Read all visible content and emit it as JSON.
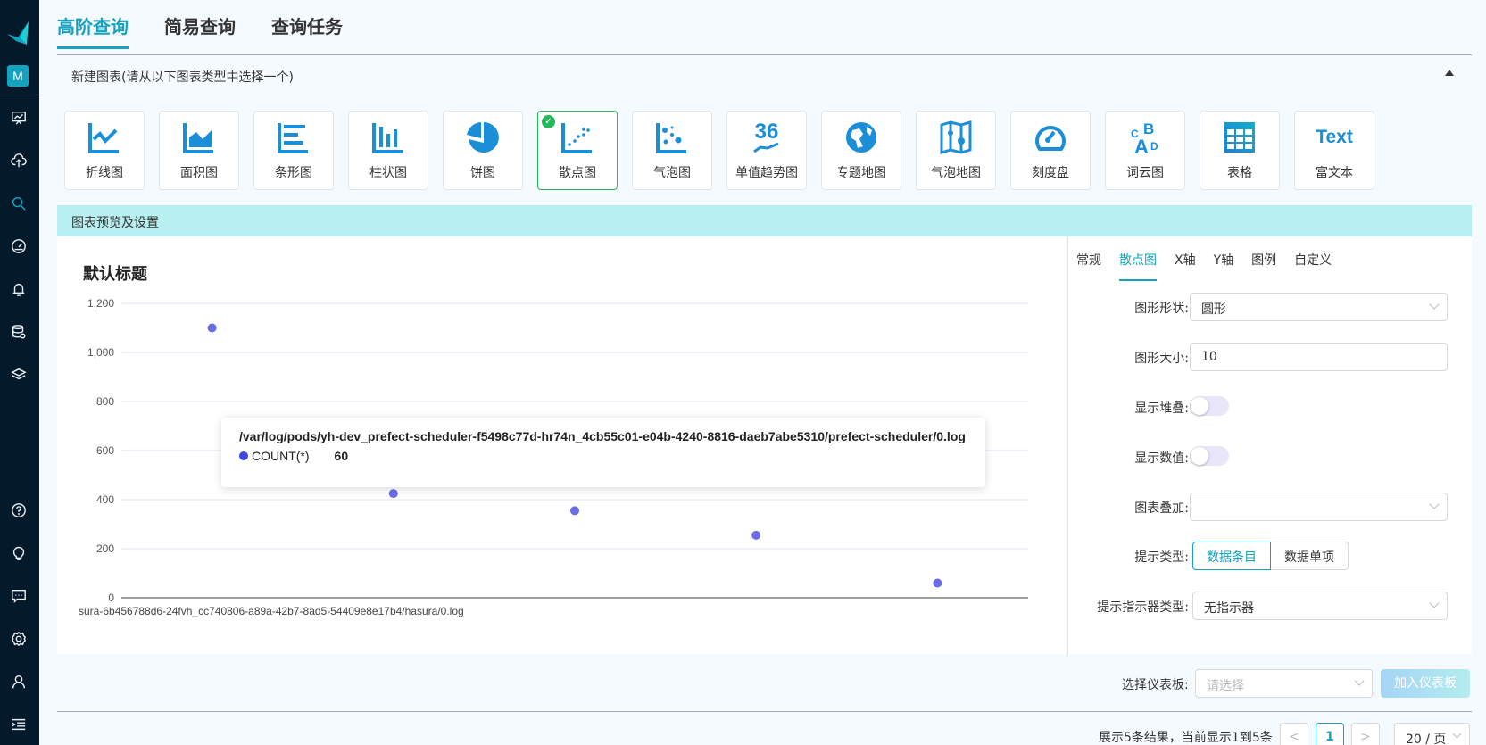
{
  "sidebar": {
    "logo": "bird-logo",
    "user_initial": "M",
    "icons_top": [
      "dashboard-presentation-icon",
      "cloud-upload-icon",
      "search-icon",
      "speedometer-icon",
      "bell-icon",
      "database-settings-icon",
      "layers-icon"
    ],
    "icons_bottom": [
      "help-icon",
      "lightbulb-icon",
      "chat-icon",
      "settings-icon",
      "user-icon",
      "menu-indent-icon"
    ],
    "active": "search-icon"
  },
  "top_tabs": [
    {
      "label": "高阶查询",
      "active": true
    },
    {
      "label": "简易查询",
      "active": false
    },
    {
      "label": "查询任务",
      "active": false
    }
  ],
  "new_chart_header": "新建图表(请从以下图表类型中选择一个)",
  "chart_types": [
    {
      "label": "折线图",
      "icon": "line-chart-icon"
    },
    {
      "label": "面积图",
      "icon": "area-chart-icon"
    },
    {
      "label": "条形图",
      "icon": "bar-chart-icon"
    },
    {
      "label": "柱状图",
      "icon": "column-chart-icon"
    },
    {
      "label": "饼图",
      "icon": "pie-chart-icon"
    },
    {
      "label": "散点图",
      "icon": "scatter-chart-icon",
      "selected": true
    },
    {
      "label": "气泡图",
      "icon": "bubble-chart-icon"
    },
    {
      "label": "单值趋势图",
      "icon": "single-value-trend-icon",
      "icon_text": "36"
    },
    {
      "label": "专题地图",
      "icon": "globe-map-icon"
    },
    {
      "label": "气泡地图",
      "icon": "bubble-map-icon"
    },
    {
      "label": "刻度盘",
      "icon": "gauge-icon"
    },
    {
      "label": "词云图",
      "icon": "word-cloud-icon"
    },
    {
      "label": "表格",
      "icon": "table-icon"
    },
    {
      "label": "富文本",
      "icon": "rich-text-icon",
      "icon_text": "Text"
    }
  ],
  "preview_header": "图表预览及设置",
  "chart": {
    "title": "默认标题",
    "tooltip": {
      "title": "/var/log/pods/yh-dev_prefect-scheduler-f5498c77d-hr74n_4cb55c01-e04b-4240-8816-daeb7abe5310/prefect-scheduler/0.log",
      "series": "COUNT(*)",
      "value": "60"
    }
  },
  "chart_data": {
    "type": "scatter",
    "title": "默认标题",
    "xlabel": "",
    "ylabel": "",
    "ylim": [
      0,
      1200
    ],
    "yticks": [
      0,
      200,
      400,
      600,
      800,
      1000,
      1200
    ],
    "ytick_labels": [
      "0",
      "200",
      "400",
      "600",
      "800",
      "1,000",
      "1,200"
    ],
    "grid": true,
    "visible_x_label": "sura-6b456788d6-24fvh_cc740806-a89a-42b7-8ad5-54409e8e17b4/hasura/0.log",
    "series": [
      {
        "name": "COUNT(*)",
        "color": "#6b6ce8",
        "values": [
          1100,
          425,
          355,
          255,
          60
        ]
      }
    ]
  },
  "settings": {
    "tabs": [
      {
        "label": "常规",
        "active": false
      },
      {
        "label": "散点图",
        "active": true
      },
      {
        "label": "X轴",
        "active": false
      },
      {
        "label": "Y轴",
        "active": false
      },
      {
        "label": "图例",
        "active": false
      },
      {
        "label": "自定义",
        "active": false
      }
    ],
    "shape_label": "图形形状:",
    "shape_value": "圆形",
    "size_label": "图形大小:",
    "size_value": "10",
    "stack_label": "显示堆叠:",
    "stack_on": false,
    "values_label": "显示数值:",
    "values_on": false,
    "overlay_label": "图表叠加:",
    "overlay_value": "",
    "tip_type_label": "提示类型:",
    "tip_type_options": [
      "数据条目",
      "数据单项"
    ],
    "tip_type_selected": "数据条目",
    "indicator_label": "提示指示器类型:",
    "indicator_value": "无指示器"
  },
  "bottom": {
    "dashboard_label": "选择仪表板:",
    "dashboard_placeholder": "请选择",
    "add_dashboard": "加入仪表板",
    "pager_info": "展示5条结果，当前显示1到5条",
    "prev": "<",
    "page": "1",
    "next": ">",
    "page_size": "20 / 页"
  },
  "colors": {
    "accent": "#13a3c0",
    "selected_border": "#23b85a",
    "point": "#6b6ce8",
    "preview_band": "#b8eff0",
    "sidebar_bg": "#04192a"
  }
}
